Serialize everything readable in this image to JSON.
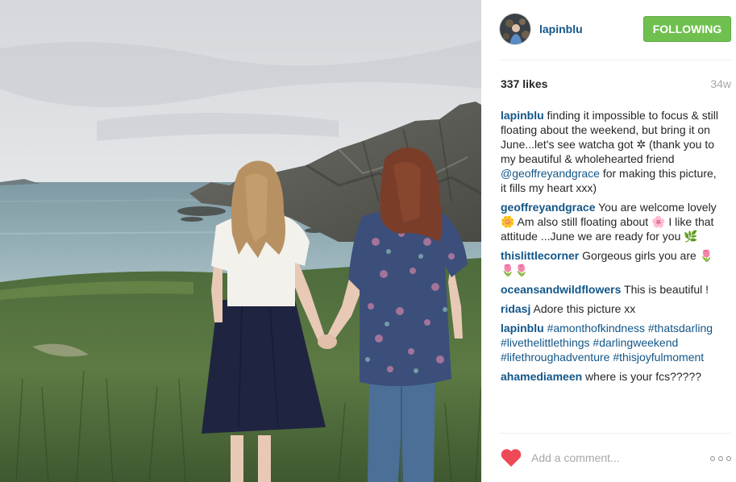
{
  "post": {
    "username": "lapinblu",
    "follow_label": "FOLLOWING",
    "likes": "337 likes",
    "time": "34w"
  },
  "comments": [
    {
      "user": "lapinblu",
      "parts": [
        {
          "t": "text",
          "v": " finding it impossible to focus & still floating about the weekend, but bring it on June...let's see watcha got ✲ (thank you to my beautiful & wholehearted friend "
        },
        {
          "t": "link",
          "v": "@geoffreyandgrace"
        },
        {
          "t": "text",
          "v": " for making this picture, it fills my heart xxx)"
        }
      ]
    },
    {
      "user": "geoffreyandgrace",
      "parts": [
        {
          "t": "text",
          "v": " You are welcome lovely 🌼 Am also still floating about 🌸 I like that attitude ...June we are ready for you 🌿"
        }
      ]
    },
    {
      "user": "thislittlecorner",
      "parts": [
        {
          "t": "text",
          "v": " Gorgeous girls you are 🌷🌷🌷"
        }
      ]
    },
    {
      "user": "oceansandwildflowers",
      "parts": [
        {
          "t": "text",
          "v": " This is beautiful !"
        }
      ]
    },
    {
      "user": "ridasj",
      "parts": [
        {
          "t": "text",
          "v": " Adore this picture xx"
        }
      ]
    },
    {
      "user": "lapinblu",
      "parts": [
        {
          "t": "text",
          "v": " "
        },
        {
          "t": "link",
          "v": "#amonthofkindness"
        },
        {
          "t": "text",
          "v": " "
        },
        {
          "t": "link",
          "v": "#thatsdarling"
        },
        {
          "t": "text",
          "v": " "
        },
        {
          "t": "link",
          "v": "#livethelittlethings"
        },
        {
          "t": "text",
          "v": " "
        },
        {
          "t": "link",
          "v": "#darlingweekend"
        },
        {
          "t": "text",
          "v": " "
        },
        {
          "t": "link",
          "v": "#lifethroughadventure"
        },
        {
          "t": "text",
          "v": " "
        },
        {
          "t": "link",
          "v": "#thisjoyfulmoment"
        }
      ]
    },
    {
      "user": "ahamediameen",
      "parts": [
        {
          "t": "text",
          "v": " where is your fcs?????"
        }
      ]
    }
  ],
  "comment_box": {
    "placeholder": "Add a comment..."
  },
  "icons": {
    "like": "heart-icon",
    "more": "more-options-icon"
  },
  "colors": {
    "link": "#125688",
    "follow": "#70c050",
    "heart": "#ed4956",
    "muted": "#a5a7aa"
  }
}
